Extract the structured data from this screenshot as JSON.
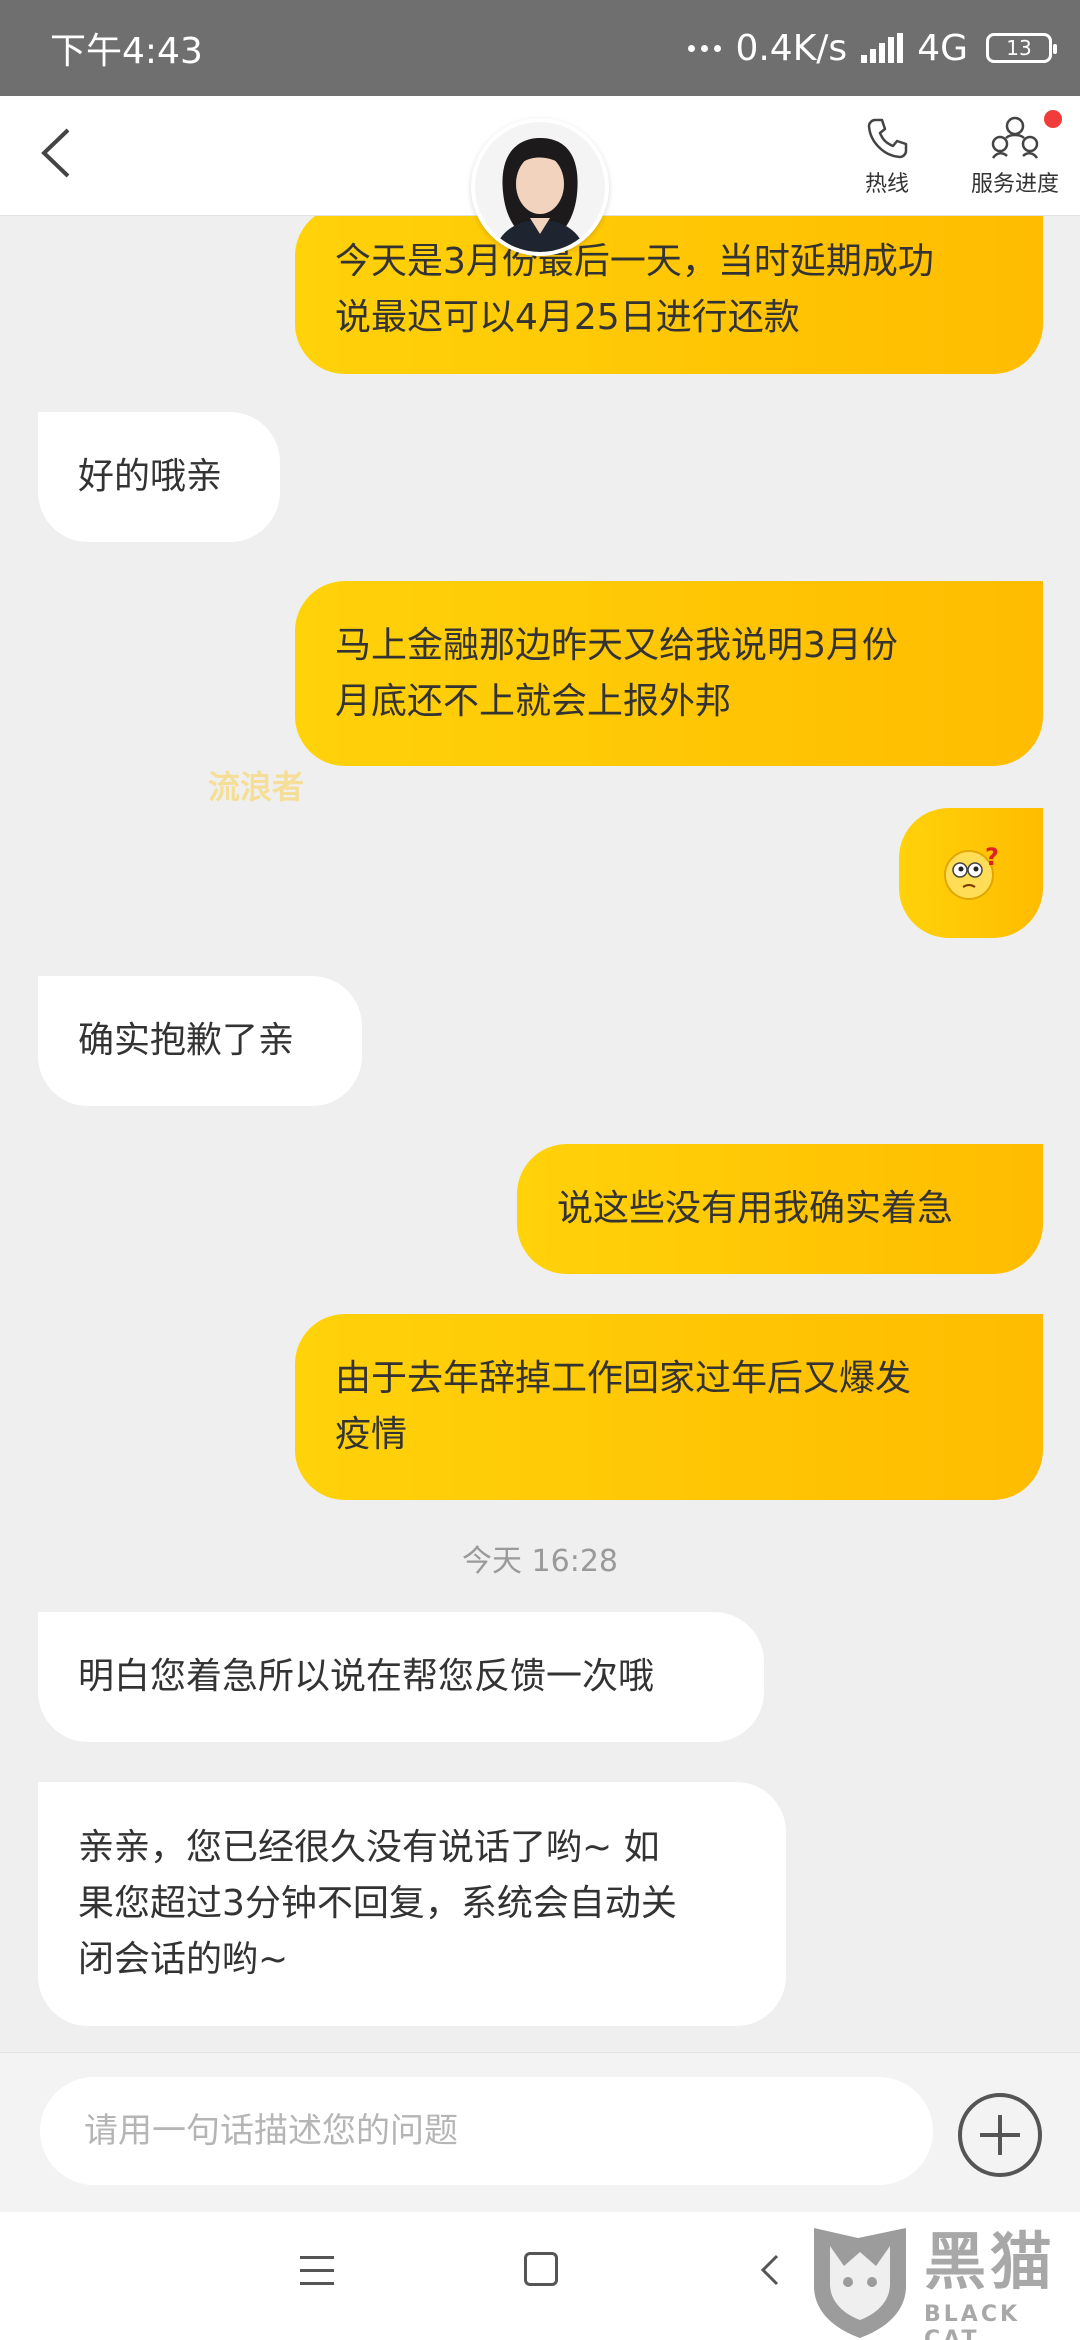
{
  "status_bar": {
    "time": "下午4:43",
    "network_speed": "0.4K/s",
    "network_type": "4G",
    "battery": "13"
  },
  "header": {
    "back_icon": "chevron-left-icon",
    "hotline_label": "热线",
    "hotline_icon": "phone-icon",
    "progress_label": "服务进度",
    "progress_icon": "people-group-icon",
    "badge_color": "#f23b3b"
  },
  "messages": [
    {
      "side": "me",
      "text": "今天是3月份最后一天，当时延期成功\n说最迟可以4月25日进行还款"
    },
    {
      "side": "bot",
      "text": "好的哦亲"
    },
    {
      "side": "me",
      "text": "马上金融那边昨天又给我说明3月份\n月底还不上就会上报外邦"
    },
    {
      "side": "me",
      "type": "emoji",
      "text": "",
      "icon": "confused-face-emoji-icon"
    },
    {
      "side": "bot",
      "text": "确实抱歉了亲"
    },
    {
      "side": "me",
      "text": "说这些没有用我确实着急"
    },
    {
      "side": "me",
      "text": "由于去年辞掉工作回家过年后又爆发\n疫情"
    },
    {
      "side": "bot",
      "text": "明白您着急所以说在帮您反馈一次哦"
    },
    {
      "side": "bot",
      "text": "亲亲，您已经很久没有说话了哟~ 如\n果您超过3分钟不回复，系统会自动关\n闭会话的哟~"
    }
  ],
  "watermark": "流浪者",
  "timestamp": "今天 16:28",
  "input": {
    "placeholder": "请用一句话描述您的问题",
    "value": ""
  },
  "brand": {
    "cn": "黑猫",
    "en": "BLACK CAT"
  },
  "colors": {
    "bubble_me_start": "#ffd20a",
    "bubble_me_end": "#ffbc00",
    "bubble_bot": "#ffffff",
    "background": "#efefef"
  }
}
